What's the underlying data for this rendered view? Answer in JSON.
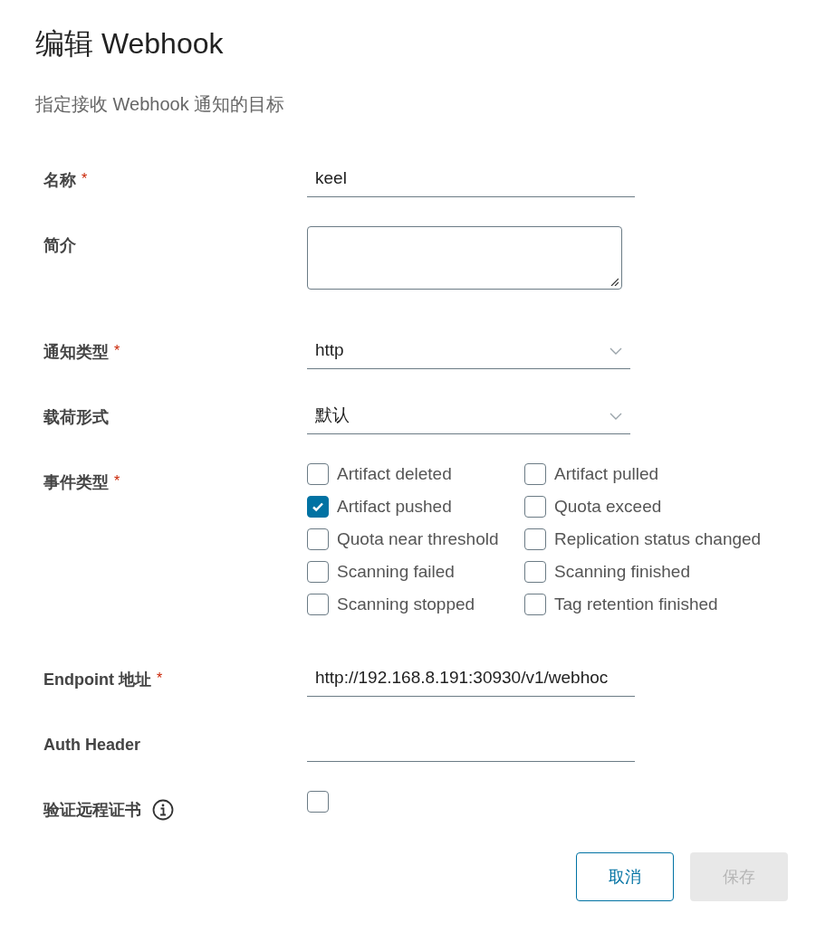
{
  "title": "编辑 Webhook",
  "subtitle": "指定接收 Webhook 通知的目标",
  "fields": [
    {
      "kind": "text",
      "label": "名称",
      "asterisk": "*",
      "value": "keel"
    },
    {
      "kind": "textarea",
      "label": "简介"
    },
    {
      "kind": "select",
      "label": "通知类型",
      "asterisk": "*",
      "value": "http"
    },
    {
      "kind": "select",
      "label": "载荷形式",
      "value": "默认"
    },
    {
      "kind": "checkboxes",
      "label": "事件类型",
      "asterisk": "*",
      "options": [
        {
          "label": "Artifact deleted",
          "checked": false
        },
        {
          "label": "Artifact pulled",
          "checked": false
        },
        {
          "label": "Artifact pushed",
          "checked": true
        },
        {
          "label": "Quota exceed",
          "checked": false
        },
        {
          "label": "Quota near threshold",
          "checked": false
        },
        {
          "label": "Replication status changed",
          "checked": false
        },
        {
          "label": "Scanning failed",
          "checked": false
        },
        {
          "label": "Scanning finished",
          "checked": false
        },
        {
          "label": "Scanning stopped",
          "checked": false
        },
        {
          "label": "Tag retention finished",
          "checked": false
        }
      ]
    },
    {
      "kind": "text",
      "label": "Endpoint 地址",
      "asterisk": "*",
      "value": "http://192.168.8.191:30930/v1/webhoc"
    },
    {
      "kind": "text",
      "label": "Auth Header"
    },
    {
      "kind": "checkbox",
      "label": "验证远程证书",
      "info": true,
      "checked": false
    }
  ],
  "buttons": [
    {
      "label": "取消",
      "disabled": false
    },
    {
      "label": "保存",
      "disabled": true
    }
  ]
}
